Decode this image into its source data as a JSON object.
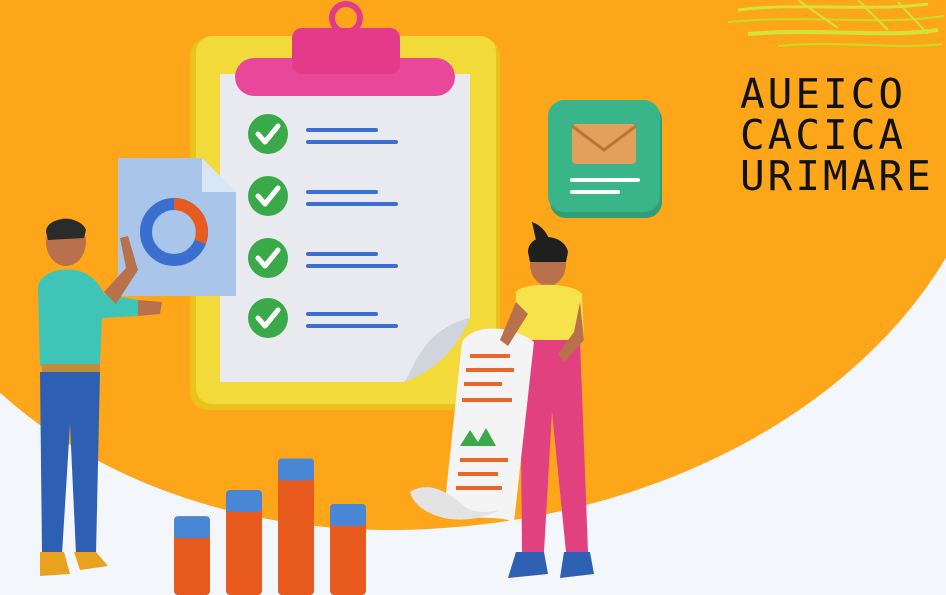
{
  "brand": {
    "logo_text": "AUEICO CACICA URIMARE",
    "logo_line_1": "AUEICO",
    "logo_line_2": "CACICA",
    "logo_line_3": "URIMARE"
  },
  "illustration": {
    "subject": "clipboard-checklist",
    "checklist_items": 4,
    "bar_values": [
      45,
      60,
      78,
      52
    ],
    "bar_colors": [
      "#e85a1d",
      "#4a86d6"
    ],
    "palette": {
      "background_accent": "#fda61a",
      "background_light": "#f3f6fa",
      "clipboard": "#f0d83a",
      "clip": "#e83d8c",
      "check": "#3aa94a",
      "envelope_tile": "#3ab58a"
    }
  }
}
